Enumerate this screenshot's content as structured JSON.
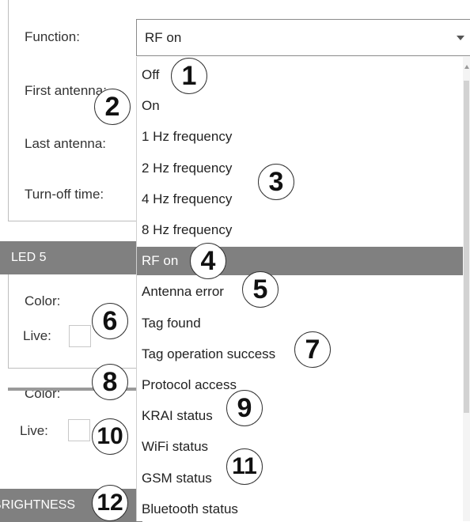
{
  "antenna_panel": {
    "function_label": "Function:",
    "first_antenna_label": "First antenna:",
    "last_antenna_label": "Last antenna:",
    "turn_off_time_label": "Turn-off time:"
  },
  "function_select": {
    "selected_value": "RF on"
  },
  "led5_section": {
    "header": "LED 5",
    "color_label": "Color:",
    "live_label": "Live:"
  },
  "led6_section": {
    "color_label": "Color:",
    "live_label": "Live:"
  },
  "brightness_section": {
    "header": "BRIGHTNESS"
  },
  "dropdown": {
    "options": [
      "Off",
      "On",
      "1 Hz frequency",
      "2 Hz frequency",
      "4 Hz frequency",
      "8 Hz frequency",
      "RF on",
      "Antenna error",
      "Tag found",
      "Tag operation success",
      "Protocol access",
      "KRAI status",
      "WiFi status",
      "GSM status",
      "Bluetooth status"
    ],
    "selected_index": 6
  },
  "callouts": [
    "1",
    "2",
    "3",
    "4",
    "5",
    "6",
    "7",
    "8",
    "9",
    "10",
    "11",
    "12"
  ],
  "colors": {
    "selected_bg": "#808080",
    "header_bg": "#808080",
    "border": "#8a8a8a"
  }
}
